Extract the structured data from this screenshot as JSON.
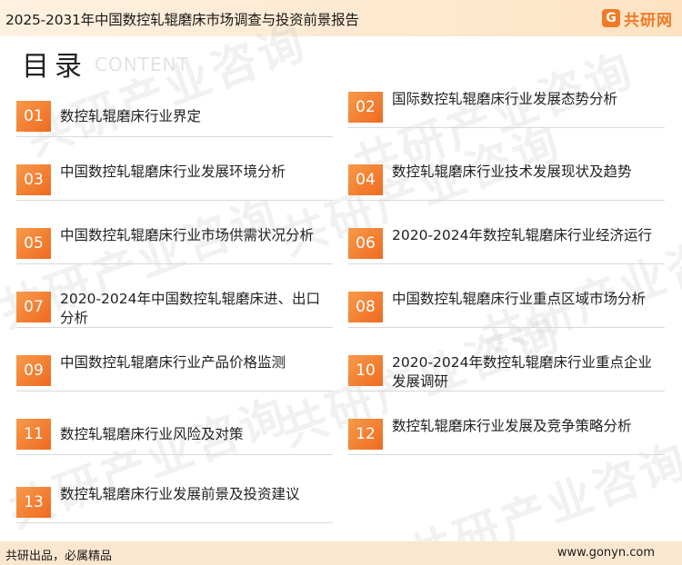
{
  "header": {
    "title": "2025-2031年中国数控轧辊磨床市场调查与投资前景报告",
    "logo_mark": "G",
    "logo_text": "共研网"
  },
  "heading": {
    "cn": "目录",
    "en": "CONTENT"
  },
  "watermark": {
    "text": "共研产业咨询",
    "url_text": "gonyn.com"
  },
  "colors": {
    "accent": "#ef6a20",
    "accent_light": "#f79a4a",
    "header_bg": "#fde3c4",
    "footer_bg": "#fbe7cf"
  },
  "items": [
    {
      "num": "01",
      "label": "数控轧辊磨床行业界定"
    },
    {
      "num": "02",
      "label": "国际数控轧辊磨床行业发展态势分析"
    },
    {
      "num": "03",
      "label": "中国数控轧辊磨床行业发展环境分析"
    },
    {
      "num": "04",
      "label": "数控轧辊磨床行业技术发展现状及趋势"
    },
    {
      "num": "05",
      "label": "中国数控轧辊磨床行业市场供需状况分析"
    },
    {
      "num": "06",
      "label": "2020-2024年数控轧辊磨床行业经济运行"
    },
    {
      "num": "07",
      "label": "2020-2024年中国数控轧辊磨床进、出口分析"
    },
    {
      "num": "08",
      "label": "中国数控轧辊磨床行业重点区域市场分析"
    },
    {
      "num": "09",
      "label": "中国数控轧辊磨床行业产品价格监测"
    },
    {
      "num": "10",
      "label": "2020-2024年数控轧辊磨床行业重点企业发展调研"
    },
    {
      "num": "11",
      "label": "数控轧辊磨床行业风险及对策"
    },
    {
      "num": "12",
      "label": "数控轧辊磨床行业发展及竞争策略分析"
    },
    {
      "num": "13",
      "label": "数控轧辊磨床行业发展前景及投资建议"
    }
  ],
  "footer": {
    "left": "共研出品，必属精品",
    "right": "www.gonyn.com"
  }
}
